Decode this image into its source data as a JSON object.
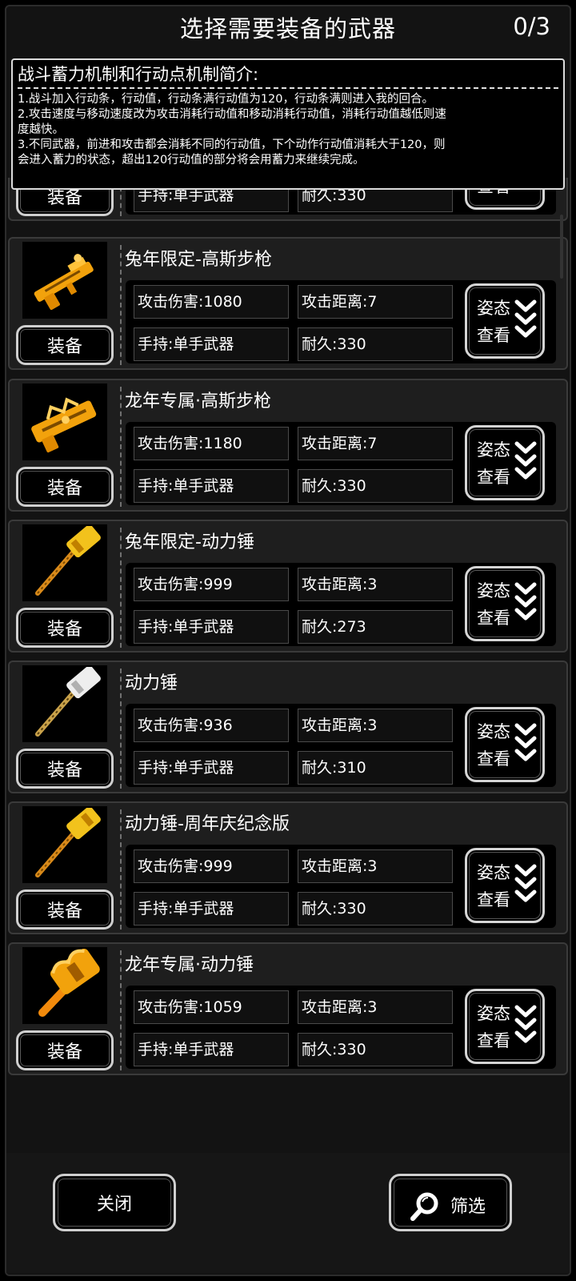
{
  "header": {
    "title": "选择需要装备的武器",
    "count": "0/3"
  },
  "info": {
    "title": "战斗蓄力机制和行动点机制简介:",
    "lines": [
      "1.战斗加入行动条，行动值，行动条满行动值为120，行动条满则进入我的回合。",
      "2.攻击速度与移动速度改为攻击消耗行动值和移动消耗行动值，消耗行动值越低则速",
      "度越快。",
      "3.不同武器，前进和攻击都会消耗不同的行动值，下个动作行动值消耗大于120，则",
      "会进入蓄力的状态，超出120行动值的部分将会用蓄力来继续完成。"
    ]
  },
  "labels": {
    "equip": "装备",
    "stance_top": "姿态",
    "stance_bottom": "查看"
  },
  "partial_card": {
    "hold": "手持:单手武器",
    "durability": "耐久:330"
  },
  "weapons": [
    {
      "name": "兔年限定-高斯步枪",
      "attack": "攻击伤害:1080",
      "range": "攻击距离:7",
      "hold": "手持:单手武器",
      "durability": "耐久:330",
      "icon": "rabbit-gauss-rifle-icon"
    },
    {
      "name": "龙年专属·高斯步枪",
      "attack": "攻击伤害:1180",
      "range": "攻击距离:7",
      "hold": "手持:单手武器",
      "durability": "耐久:330",
      "icon": "dragon-gauss-rifle-icon"
    },
    {
      "name": "兔年限定-动力锤",
      "attack": "攻击伤害:999",
      "range": "攻击距离:3",
      "hold": "手持:单手武器",
      "durability": "耐久:273",
      "icon": "rabbit-power-hammer-icon"
    },
    {
      "name": "动力锤",
      "attack": "攻击伤害:936",
      "range": "攻击距离:3",
      "hold": "手持:单手武器",
      "durability": "耐久:310",
      "icon": "power-hammer-icon"
    },
    {
      "name": "动力锤-周年庆纪念版",
      "attack": "攻击伤害:999",
      "range": "攻击距离:3",
      "hold": "手持:单手武器",
      "durability": "耐久:330",
      "icon": "anniversary-power-hammer-icon"
    },
    {
      "name": "龙年专属·动力锤",
      "attack": "攻击伤害:1059",
      "range": "攻击距离:3",
      "hold": "手持:单手武器",
      "durability": "耐久:330",
      "icon": "dragon-power-hammer-icon"
    }
  ],
  "footer": {
    "close": "关闭",
    "filter": "筛选"
  },
  "colors": {
    "accent_gold": "#f2a20c",
    "panel": "#1e1e1e",
    "border": "#cfcfcf"
  }
}
